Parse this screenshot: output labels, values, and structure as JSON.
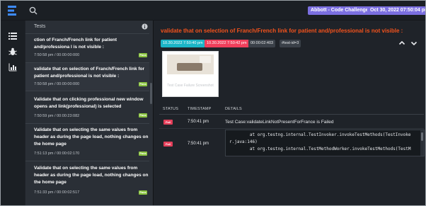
{
  "header": {
    "project_badge": "Abbott - Code Challenge",
    "date_badge": "Oct 30, 2022 07:50:04 pm"
  },
  "tests_panel": {
    "title": "Tests",
    "items": [
      {
        "name": "ction of Franch/French link for patient and/professiona l is not visible :",
        "meta": "7:50:58 pm / 00:00:00:000",
        "status": "Pass"
      },
      {
        "name": "validate that on selection of Franch/French link for patient and/professional is not visible :",
        "meta": "7:50:58 pm / 00:00:00:000",
        "status": "Pass"
      },
      {
        "name": "Validate that on clicking professional new window opens and link(professional) is selected",
        "meta": "7:50:59 pm / 00:00:23:082",
        "status": "Pass"
      },
      {
        "name": "Validate that on selecting the same values from header as during the page load, nothing changes on the home page",
        "meta": "7:51:13 pm / 00:00:02:170",
        "status": "Pass"
      },
      {
        "name": "Validate that on selecting the same values from header as during the page load, nothing changes on the home page",
        "meta": "7:51:33 pm / 00:00:02:517",
        "status": "Pass"
      }
    ]
  },
  "detail": {
    "title": "validate that on selection of Franch/French link for patient and/professional is not visible :",
    "start_time": "10.30.2022 7:50:40 pm",
    "end_time": "10.30.2022 7:50:42 pm",
    "duration": "00:00:02:403",
    "test_id": "#test-id=3",
    "screenshot_caption": "Test Case Failure Screenshot",
    "columns": {
      "status": "STATUS",
      "timestamp": "TIMESTAMP",
      "details": "DETAILS"
    },
    "rows": [
      {
        "status": "Fail",
        "time": "7:50:41 pm",
        "details": "Test Case:validateLinkNotPresentForFrance is Failed"
      },
      {
        "status": "Fail",
        "time": "7:50:41 pm",
        "details": "        at org.testng.internal.TestInvoker.invokeTestMethods(TestInvoke\nr.java:146)\n        at org.testng.internal.TestMethodWorker.invokeTestMethods(TestM"
      }
    ]
  },
  "colors": {
    "accent_purple": "#7b6fe0",
    "title_orange": "#f3521c",
    "pass_green": "#8ac43f",
    "fail_red": "#e43f5a",
    "start_teal": "#1bb5c7"
  },
  "icons": {
    "logo": "extent-logo-icon",
    "search": "search-icon",
    "nav": [
      "list-icon",
      "bug-icon",
      "bar-chart-icon"
    ],
    "info": "info-icon",
    "chevrons": [
      "chevron-up-icon",
      "chevron-down-icon"
    ]
  }
}
